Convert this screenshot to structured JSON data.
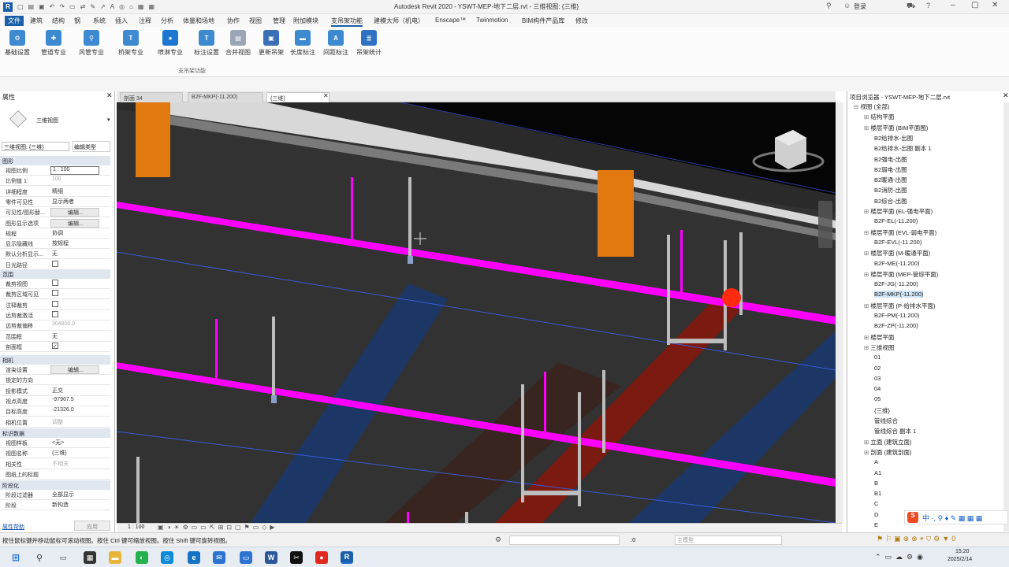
{
  "title": "Autodesk Revit 2020 - YSWT-MEP-地下二层.rvt - 三维视图: {三维}",
  "login_label": "登录",
  "menus": [
    "文件",
    "建筑",
    "结构",
    "钢",
    "系统",
    "插入",
    "注释",
    "分析",
    "体量和场地",
    "协作",
    "视图",
    "管理",
    "附加模块",
    "支吊架功能",
    "建模大师（机电）",
    "Enscape™",
    "Twinmotion",
    "BIM构件产品库",
    "修改"
  ],
  "ribbon": {
    "buttons": [
      "基础设置",
      "管道专业",
      "风管专业",
      "桥架专业",
      "喷淋专业",
      "标注设置",
      "合并视图",
      "更新吊架",
      "长度标注",
      "间距标注",
      "吊架统计"
    ],
    "panel_title": "支吊架功能"
  },
  "tabs": [
    {
      "label": "剖面 34"
    },
    {
      "label": "B2F-MKP(-11.200)"
    },
    {
      "label": "{三维}"
    }
  ],
  "properties": {
    "header": "属性",
    "type_name": "三维视图",
    "selector_value": "三维视图: {三维}",
    "edit_type_label": "编辑类型",
    "sections": {
      "graphics": "图形",
      "extents": "范围",
      "camera": "相机",
      "identity": "标识数据",
      "phasing": "阶段化"
    },
    "rows": [
      {
        "k": "视图比例",
        "v": "1 : 100"
      },
      {
        "k": "比例值 1:",
        "v": "100"
      },
      {
        "k": "详细程度",
        "v": "精细"
      },
      {
        "k": "零件可见性",
        "v": "显示两者"
      },
      {
        "k": "可见性/图形替...",
        "v": "编辑..."
      },
      {
        "k": "图形显示选项",
        "v": "编辑..."
      },
      {
        "k": "规程",
        "v": "协调"
      },
      {
        "k": "显示隐藏线",
        "v": "按规程"
      },
      {
        "k": "默认分析显示...",
        "v": "无"
      },
      {
        "k": "日光路径",
        "v": ""
      },
      {
        "k": "裁剪视图",
        "v": ""
      },
      {
        "k": "裁剪区域可见",
        "v": ""
      },
      {
        "k": "注释裁剪",
        "v": ""
      },
      {
        "k": "远剪裁激活",
        "v": ""
      },
      {
        "k": "远剪裁偏移",
        "v": "304800.0"
      },
      {
        "k": "范围框",
        "v": "无"
      },
      {
        "k": "剖面框",
        "v": ""
      },
      {
        "k": "渲染设置",
        "v": "编辑..."
      },
      {
        "k": "锁定的方向",
        "v": ""
      },
      {
        "k": "投影模式",
        "v": "正交"
      },
      {
        "k": "视点高度",
        "v": "-97967.5"
      },
      {
        "k": "目标高度",
        "v": "-21326.0"
      },
      {
        "k": "相机位置",
        "v": "调整"
      },
      {
        "k": "视图样板",
        "v": "<无>"
      },
      {
        "k": "视图名称",
        "v": "{三维}"
      },
      {
        "k": "相关性",
        "v": "不相关"
      },
      {
        "k": "图纸上的标题",
        "v": ""
      },
      {
        "k": "阶段过滤器",
        "v": "全部显示"
      },
      {
        "k": "阶段",
        "v": "新构造"
      }
    ],
    "help_link": "属性帮助",
    "apply_label": "应用"
  },
  "browser": {
    "header": "项目浏览器 - YSWT-MEP-地下二层.rvt",
    "items": [
      {
        "level": 0,
        "label": "视图 (全部)"
      },
      {
        "level": 1,
        "label": "结构平面"
      },
      {
        "level": 1,
        "label": "楼层平面 (BIM平面图)"
      },
      {
        "level": 2,
        "label": "B2给排水-出图"
      },
      {
        "level": 2,
        "label": "B2给排水-出图 副本 1"
      },
      {
        "level": 2,
        "label": "B2强电-出图"
      },
      {
        "level": 2,
        "label": "B2弱电-出图"
      },
      {
        "level": 2,
        "label": "B2暖通-出图"
      },
      {
        "level": 2,
        "label": "B2消防-出图"
      },
      {
        "level": 2,
        "label": "B2综合-出图"
      },
      {
        "level": 1,
        "label": "楼层平面 (EL-强电平面)"
      },
      {
        "level": 2,
        "label": "B2F-EL(-11.200)"
      },
      {
        "level": 1,
        "label": "楼层平面 (EVL-弱电平面)"
      },
      {
        "level": 2,
        "label": "B2F-EVL(-11.200)"
      },
      {
        "level": 1,
        "label": "楼层平面 (M-暖通平面)"
      },
      {
        "level": 2,
        "label": "B2F-ME(-11.200)"
      },
      {
        "level": 1,
        "label": "楼层平面 (MEP-管综平面)"
      },
      {
        "level": 2,
        "label": "B2F-JG(-11.200)"
      },
      {
        "level": 2,
        "label": "B2F-MKP(-11.200)"
      },
      {
        "level": 1,
        "label": "楼层平面 (P-给排水平面)"
      },
      {
        "level": 2,
        "label": "B2F-PM(-11.200)"
      },
      {
        "level": 2,
        "label": "B2F-ZP(-11.200)"
      },
      {
        "level": 1,
        "label": "楼层平面"
      },
      {
        "level": 1,
        "label": "三维视图"
      },
      {
        "level": 2,
        "label": "01"
      },
      {
        "level": 2,
        "label": "02"
      },
      {
        "level": 2,
        "label": "03"
      },
      {
        "level": 2,
        "label": "04"
      },
      {
        "level": 2,
        "label": "05"
      },
      {
        "level": 2,
        "label": "{三维}"
      },
      {
        "level": 2,
        "label": "管线综合"
      },
      {
        "level": 2,
        "label": "管线综合 副本 1"
      },
      {
        "level": 1,
        "label": "立面 (建筑立面)"
      },
      {
        "level": 1,
        "label": "剖面 (建筑剖面)"
      },
      {
        "level": 2,
        "label": "A"
      },
      {
        "level": 2,
        "label": "A1"
      },
      {
        "level": 2,
        "label": "B"
      },
      {
        "level": 2,
        "label": "B1"
      },
      {
        "level": 2,
        "label": "C"
      },
      {
        "level": 2,
        "label": "D"
      },
      {
        "level": 2,
        "label": "E"
      }
    ]
  },
  "viewctrl": {
    "scale": "1 : 100"
  },
  "status": {
    "hint": "按住鼠标键并移动鼠标可滚动视图。按住 Ctrl 键可缩放视图。按住 Shift 键可旋转视图。",
    "coord": ":0",
    "model": "主模型"
  },
  "taskbar": {
    "time": "15:20",
    "date": "2025/2/14"
  },
  "colors": {
    "pipe": "#ff00ff",
    "blue": "#1d3f7a",
    "red": "#8b1a10",
    "orange": "#e07a10"
  }
}
